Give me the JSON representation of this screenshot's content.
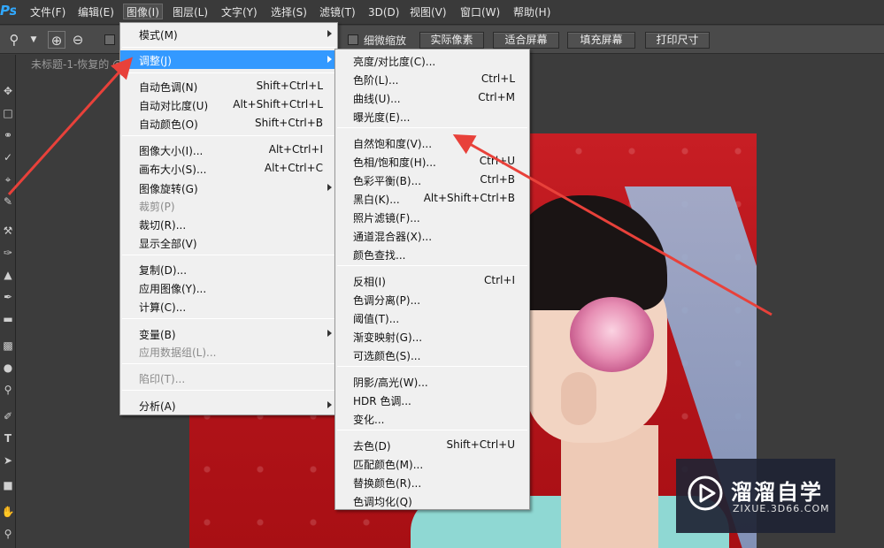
{
  "app": {
    "logo": "Ps"
  },
  "menubar": {
    "items": [
      "文件(F)",
      "编辑(E)",
      "图像(I)",
      "图层(L)",
      "文字(Y)",
      "选择(S)",
      "滤镜(T)",
      "3D(D)",
      "视图(V)",
      "窗口(W)",
      "帮助(H)"
    ],
    "active": "图像(I)"
  },
  "options": {
    "checkbox_label": "细微缩放",
    "buttons": [
      "实际像素",
      "适合屏幕",
      "填充屏幕",
      "打印尺寸"
    ]
  },
  "document": {
    "tab_title": "未标题-1-恢复的 @"
  },
  "image_menu": {
    "items": [
      {
        "label": "模式(M)",
        "shortcut": "",
        "submenu": true
      },
      {
        "label": "调整(J)",
        "shortcut": "",
        "submenu": true,
        "highlighted": true
      },
      {
        "label": "自动色调(N)",
        "shortcut": "Shift+Ctrl+L"
      },
      {
        "label": "自动对比度(U)",
        "shortcut": "Alt+Shift+Ctrl+L"
      },
      {
        "label": "自动颜色(O)",
        "shortcut": "Shift+Ctrl+B"
      },
      {
        "label": "图像大小(I)...",
        "shortcut": "Alt+Ctrl+I"
      },
      {
        "label": "画布大小(S)...",
        "shortcut": "Alt+Ctrl+C"
      },
      {
        "label": "图像旋转(G)",
        "shortcut": "",
        "submenu": true
      },
      {
        "label": "裁剪(P)",
        "shortcut": "",
        "disabled": true
      },
      {
        "label": "裁切(R)...",
        "shortcut": ""
      },
      {
        "label": "显示全部(V)",
        "shortcut": ""
      },
      {
        "label": "复制(D)...",
        "shortcut": ""
      },
      {
        "label": "应用图像(Y)...",
        "shortcut": ""
      },
      {
        "label": "计算(C)...",
        "shortcut": ""
      },
      {
        "label": "变量(B)",
        "shortcut": "",
        "submenu": true
      },
      {
        "label": "应用数据组(L)...",
        "shortcut": "",
        "disabled": true
      },
      {
        "label": "陷印(T)...",
        "shortcut": "",
        "disabled": true
      },
      {
        "label": "分析(A)",
        "shortcut": "",
        "submenu": true
      }
    ]
  },
  "adjust_menu": {
    "items": [
      {
        "label": "亮度/对比度(C)...",
        "shortcut": ""
      },
      {
        "label": "色阶(L)...",
        "shortcut": "Ctrl+L"
      },
      {
        "label": "曲线(U)...",
        "shortcut": "Ctrl+M"
      },
      {
        "label": "曝光度(E)...",
        "shortcut": ""
      },
      {
        "label": "自然饱和度(V)...",
        "shortcut": ""
      },
      {
        "label": "色相/饱和度(H)...",
        "shortcut": "Ctrl+U"
      },
      {
        "label": "色彩平衡(B)...",
        "shortcut": "Ctrl+B"
      },
      {
        "label": "黑白(K)...",
        "shortcut": "Alt+Shift+Ctrl+B"
      },
      {
        "label": "照片滤镜(F)...",
        "shortcut": ""
      },
      {
        "label": "通道混合器(X)...",
        "shortcut": ""
      },
      {
        "label": "颜色查找...",
        "shortcut": ""
      },
      {
        "label": "反相(I)",
        "shortcut": "Ctrl+I"
      },
      {
        "label": "色调分离(P)...",
        "shortcut": ""
      },
      {
        "label": "阈值(T)...",
        "shortcut": ""
      },
      {
        "label": "渐变映射(G)...",
        "shortcut": ""
      },
      {
        "label": "可选颜色(S)...",
        "shortcut": ""
      },
      {
        "label": "阴影/高光(W)...",
        "shortcut": ""
      },
      {
        "label": "HDR 色调...",
        "shortcut": ""
      },
      {
        "label": "变化...",
        "shortcut": ""
      },
      {
        "label": "去色(D)",
        "shortcut": "Shift+Ctrl+U"
      },
      {
        "label": "匹配颜色(M)...",
        "shortcut": ""
      },
      {
        "label": "替换颜色(R)...",
        "shortcut": ""
      },
      {
        "label": "色调均化(Q)",
        "shortcut": ""
      }
    ]
  },
  "watermark": {
    "title": "溜溜自学",
    "subtitle": "ZIXUE.3D66.COM"
  },
  "colors": {
    "highlight": "#3399ff",
    "annotation_arrow": "#e8413a",
    "ps_blue": "#31a8ff"
  },
  "tools": [
    "move-icon",
    "marquee-icon",
    "lasso-icon",
    "quick-select-icon",
    "crop-icon",
    "eyedropper-icon",
    "healing-icon",
    "brush-icon",
    "stamp-icon",
    "history-brush-icon",
    "eraser-icon",
    "gradient-icon",
    "blur-icon",
    "dodge-icon",
    "pen-icon",
    "type-icon",
    "path-select-icon",
    "shape-icon",
    "hand-icon",
    "zoom-icon"
  ]
}
